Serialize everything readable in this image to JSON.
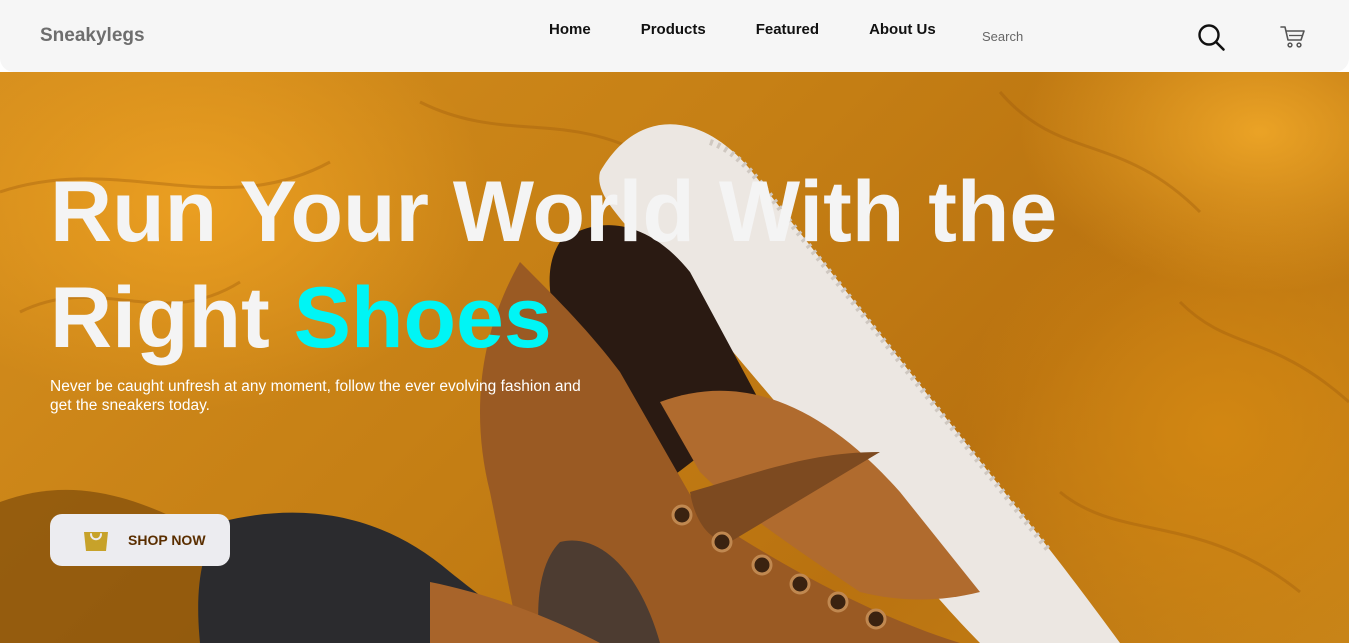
{
  "brand": "Sneakylegs",
  "nav": {
    "links": [
      "Home",
      "Products",
      "Featured",
      "About Us"
    ],
    "search_placeholder": "Search",
    "search_icon": "magnifier-icon",
    "cart_icon": "shopping-cart-icon"
  },
  "hero": {
    "headline_line1": "Run Your World With the",
    "headline_line2_prefix": "Right ",
    "headline_accent": "Shoes",
    "subtext": "Never be caught unfresh at any moment, follow the ever evolving fashion and get the sneakers today.",
    "cta_label": "SHOP NOW",
    "cta_icon": "shopping-bag-icon"
  },
  "colors": {
    "accent": "#00f5f5",
    "navbar_bg": "#f6f6f6",
    "hero_bg": "#c47e14",
    "cta_text": "#5a2e00",
    "bag_icon": "#c7a22a"
  }
}
